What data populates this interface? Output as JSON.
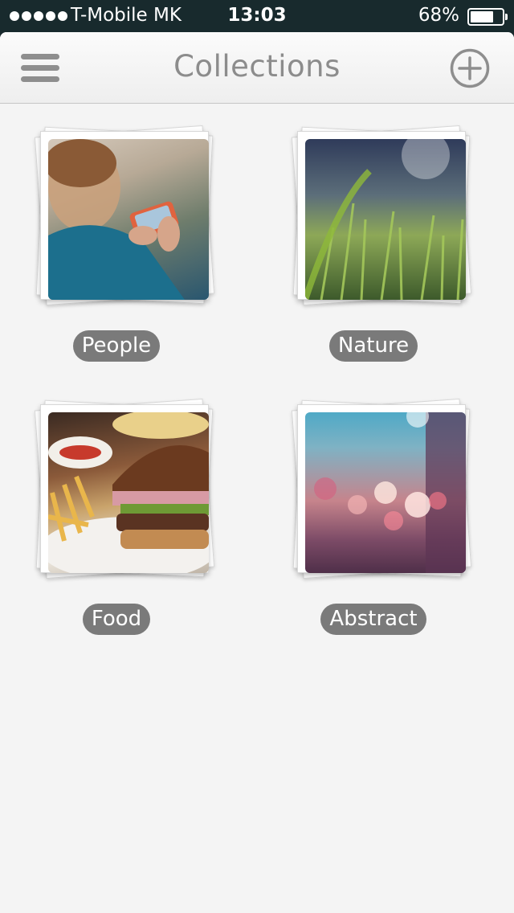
{
  "status_bar": {
    "carrier": "T-Mobile MK",
    "time": "13:03",
    "battery": "68%",
    "battery_level": 0.68
  },
  "nav": {
    "title": "Collections",
    "menu_icon": "hamburger-menu-icon",
    "add_icon": "plus-circle-icon"
  },
  "collections": [
    {
      "label": "People"
    },
    {
      "label": "Nature"
    },
    {
      "label": "Food"
    },
    {
      "label": "Abstract"
    }
  ],
  "colors": {
    "status_bar_bg": "#182a2d",
    "background": "#f4f4f4",
    "label_pill": "#7a7a7a",
    "title": "#8c8c8c"
  }
}
